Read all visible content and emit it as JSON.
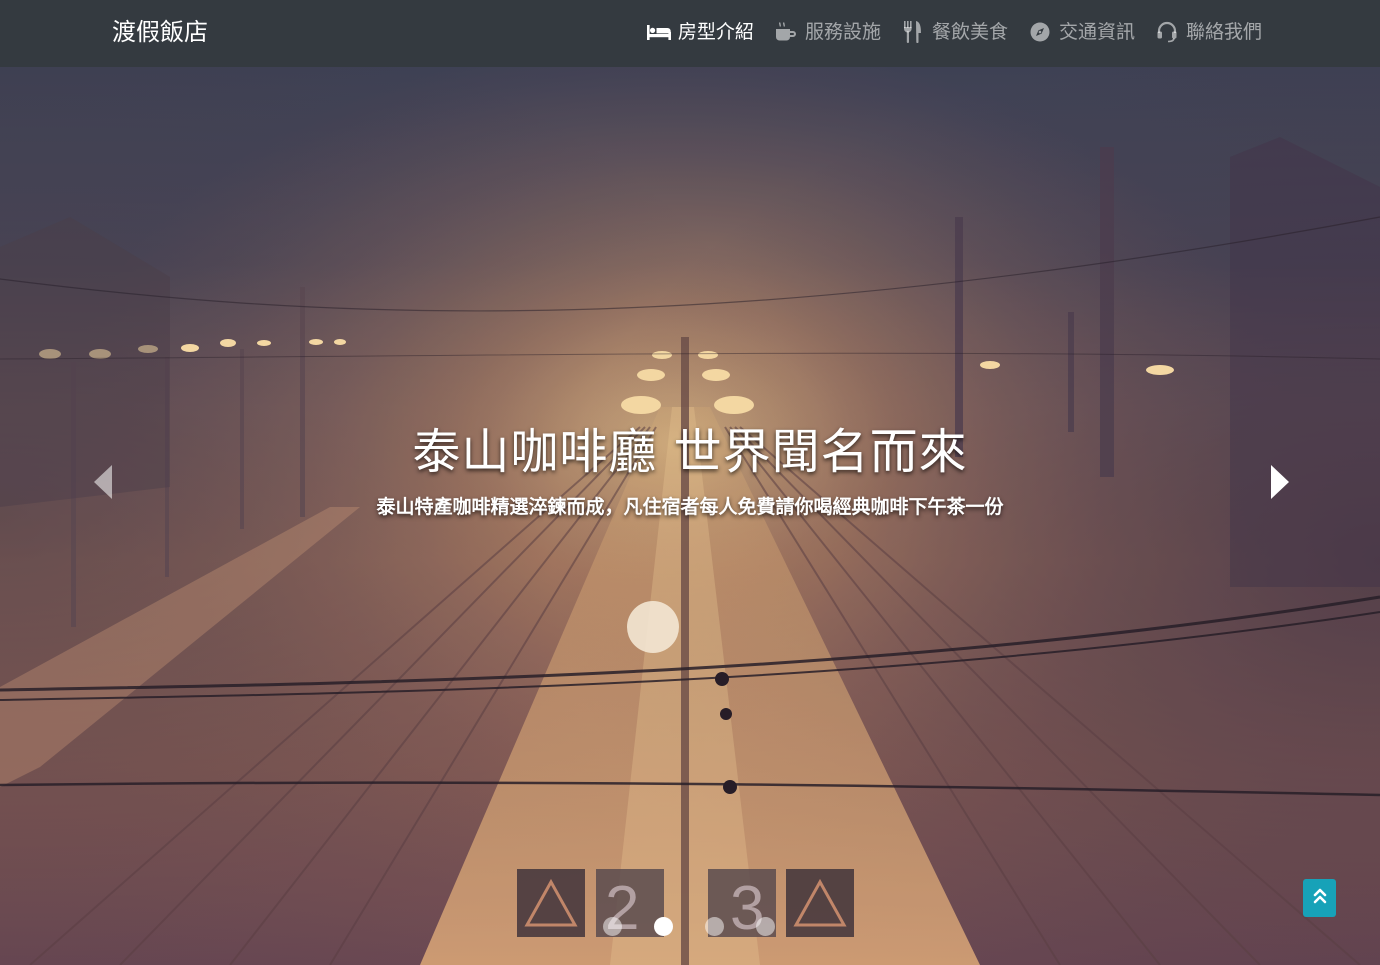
{
  "navbar": {
    "brand": "渡假飯店",
    "items": [
      {
        "label": "房型介紹",
        "icon": "bed-icon",
        "active": true
      },
      {
        "label": "服務設施",
        "icon": "coffee-mug-icon",
        "active": false
      },
      {
        "label": "餐飲美食",
        "icon": "utensils-icon",
        "active": false
      },
      {
        "label": "交通資訊",
        "icon": "compass-icon",
        "active": false
      },
      {
        "label": "聯絡我們",
        "icon": "headset-icon",
        "active": false
      }
    ]
  },
  "carousel": {
    "title": "泰山咖啡廳 世界聞名而來",
    "subtitle": "泰山特產咖啡精選淬鍊而成，凡住宿者每人免費請你喝經典咖啡下午茶一份",
    "slide_count": 4,
    "active_index": 1,
    "prev_icon": "caret-left-icon",
    "next_icon": "caret-right-icon"
  },
  "back_to_top": {
    "icon": "double-chevron-up-icon"
  },
  "colors": {
    "navbar_bg": "#343a40",
    "accent": "#17a2b8",
    "nav_active": "#ffffff",
    "nav_inactive": "rgba(255,255,255,0.55)"
  }
}
